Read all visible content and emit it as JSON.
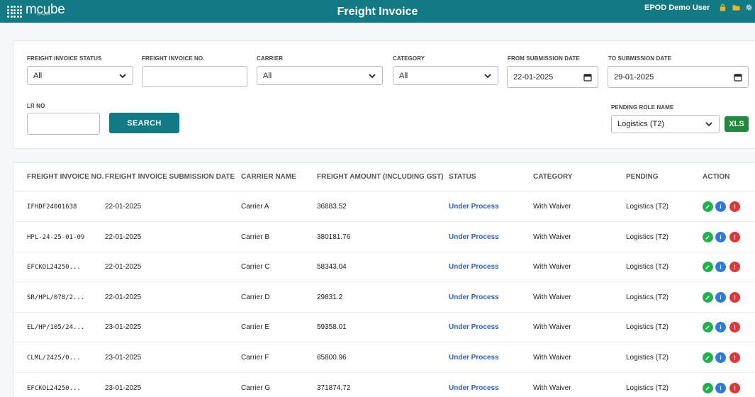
{
  "header": {
    "logo_text": "mcube",
    "logo_sub": "by loginext",
    "title": "Freight Invoice",
    "user": "EPOD Demo User"
  },
  "filters": {
    "status_label": "FREIGHT INVOICE STATUS",
    "status_value": "All",
    "invoice_no_label": "FREIGHT INVOICE NO.",
    "invoice_no_value": "",
    "carrier_label": "CARRIER",
    "carrier_value": "All",
    "category_label": "CATEGORY",
    "category_value": "All",
    "from_date_label": "FROM SUBMISSION DATE",
    "from_date_value": "22-01-2025",
    "to_date_label": "TO SUBMISSION DATE",
    "to_date_value": "29-01-2025",
    "lr_no_label": "LR NO",
    "lr_no_value": "",
    "search_label": "SEARCH",
    "pending_role_label": "PENDING ROLE NAME",
    "pending_role_value": "Logistics (T2)",
    "xls_label": "XLS"
  },
  "table": {
    "columns": [
      "FREIGHT INVOICE NO.",
      "FREIGHT INVOICE SUBMISSION DATE",
      "CARRIER NAME",
      "FREIGHT AMOUNT (INCLUDING GST)",
      "STATUS",
      "CATEGORY",
      "PENDING",
      "ACTION"
    ],
    "rows": [
      {
        "invoice_no": "IFHDF24001638",
        "date": "22-01-2025",
        "carrier": "Carrier A",
        "amount": "36883.52",
        "status": "Under Process",
        "category": "With Waiver",
        "pending": "Logistics (T2)"
      },
      {
        "invoice_no": "HPL-24-25-01-09",
        "date": "22-01-2025",
        "carrier": "Carrier B",
        "amount": "380181.76",
        "status": "Under Process",
        "category": "With Waiver",
        "pending": "Logistics (T2)"
      },
      {
        "invoice_no": "EFCKOL24250...",
        "date": "22-01-2025",
        "carrier": "Carrier C",
        "amount": "58343.04",
        "status": "Under Process",
        "category": "With Waiver",
        "pending": "Logistics (T2)"
      },
      {
        "invoice_no": "SR/HPL/078/2...",
        "date": "22-01-2025",
        "carrier": "Carrier D",
        "amount": "29831.2",
        "status": "Under Process",
        "category": "With Waiver",
        "pending": "Logistics (T2)"
      },
      {
        "invoice_no": "EL/HP/105/24...",
        "date": "23-01-2025",
        "carrier": "Carrier E",
        "amount": "59358.01",
        "status": "Under Process",
        "category": "With Waiver",
        "pending": "Logistics (T2)"
      },
      {
        "invoice_no": "CLML/2425/0...",
        "date": "23-01-2025",
        "carrier": "Carrier F",
        "amount": "85800.96",
        "status": "Under Process",
        "category": "With Waiver",
        "pending": "Logistics (T2)"
      },
      {
        "invoice_no": "EFCKOL24250...",
        "date": "23-01-2025",
        "carrier": "Carrier G",
        "amount": "371874.72",
        "status": "Under Process",
        "category": "With Waiver",
        "pending": "Logistics (T2)"
      }
    ]
  },
  "icons": {
    "lock": "lock-icon",
    "folder": "folder-icon",
    "settings": "gear-icon",
    "edit": "edit-icon",
    "info": "info-icon",
    "alert": "alert-icon"
  },
  "colors": {
    "brand": "#127a85",
    "status_link": "#2f5fc7",
    "xls": "#1f8a3b",
    "edit": "#1fb24a",
    "info": "#2f7bd9",
    "alert": "#e0363a"
  }
}
